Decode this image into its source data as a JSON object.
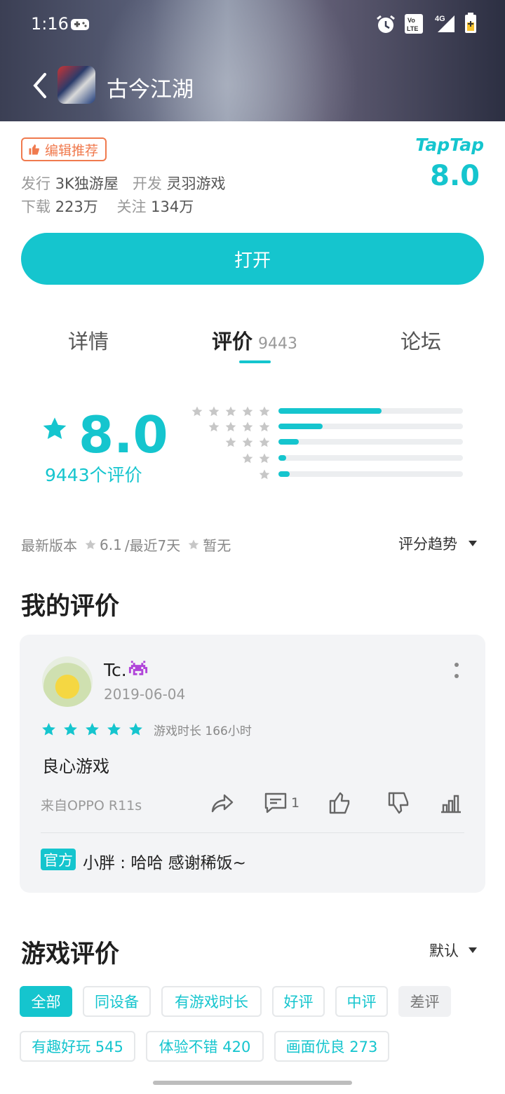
{
  "status_bar": {
    "time": "1:16",
    "network": "4G"
  },
  "header": {
    "title": "古今江湖"
  },
  "badge": {
    "label": "编辑推荐"
  },
  "meta": {
    "publisher_label": "发行",
    "publisher": "3K独游屋",
    "developer_label": "开发",
    "developer": "灵羽游戏",
    "downloads_label": "下载",
    "downloads": "223万",
    "follows_label": "关注",
    "follows": "134万"
  },
  "brand": {
    "name": "TapTap",
    "score": "8.0",
    "accent": "#15c5ce"
  },
  "open_button": {
    "label": "打开"
  },
  "tabs": [
    {
      "label": "详情"
    },
    {
      "label": "评价",
      "count": "9443"
    },
    {
      "label": "论坛"
    }
  ],
  "rating": {
    "score": "8.0",
    "count_label": "9443个评价",
    "distribution": [
      {
        "stars": 5,
        "fraction": 0.56
      },
      {
        "stars": 4,
        "fraction": 0.24
      },
      {
        "stars": 3,
        "fraction": 0.11
      },
      {
        "stars": 2,
        "fraction": 0.04
      },
      {
        "stars": 1,
        "fraction": 0.06
      }
    ]
  },
  "version": {
    "label": "最新版本",
    "latest_score": "6.1",
    "sep": "/最近7天",
    "recent_score": "暂无",
    "trend_label": "评分趋势"
  },
  "my_review": {
    "section_title": "我的评价",
    "username": "Tc.",
    "date": "2019-06-04",
    "stars": 5,
    "playtime": "游戏时长 166小时",
    "text": "良心游戏",
    "device": "来自OPPO R11s",
    "comment_count": "1",
    "official_tag": "官方",
    "official_reply": "小胖 : 哈哈 感谢稀饭~"
  },
  "game_reviews": {
    "section_title": "游戏评价",
    "sort_label": "默认",
    "filters": [
      "全部",
      "同设备",
      "有游戏时长",
      "好评",
      "中评",
      "差评"
    ],
    "tags": [
      "有趣好玩 545",
      "体验不错 420",
      "画面优良 273"
    ]
  }
}
